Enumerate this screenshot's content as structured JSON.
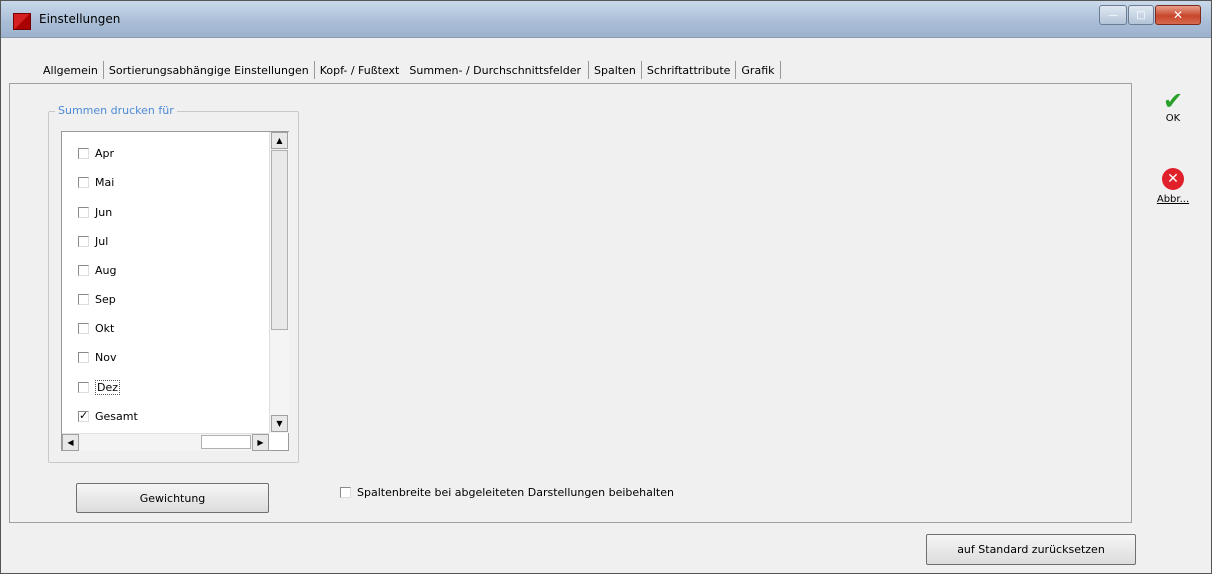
{
  "window": {
    "title": "Einstellungen"
  },
  "tabs": [
    {
      "label": "Allgemein"
    },
    {
      "label": "Sortierungsabhängige Einstellungen"
    },
    {
      "label": "Kopf- / Fußtext"
    },
    {
      "label": "Summen- / Durchschnittsfelder",
      "active": true
    },
    {
      "label": "Spalten"
    },
    {
      "label": "Schriftattribute"
    },
    {
      "label": "Grafik"
    }
  ],
  "group": {
    "title": "Summen drucken für"
  },
  "items": [
    {
      "label": "Apr",
      "checked": false
    },
    {
      "label": "Mai",
      "checked": false
    },
    {
      "label": "Jun",
      "checked": false
    },
    {
      "label": "Jul",
      "checked": false
    },
    {
      "label": "Aug",
      "checked": false
    },
    {
      "label": "Sep",
      "checked": false
    },
    {
      "label": "Okt",
      "checked": false
    },
    {
      "label": "Nov",
      "checked": false
    },
    {
      "label": "Dez",
      "checked": false
    },
    {
      "label": "Gesamt",
      "checked": true
    }
  ],
  "buttons": {
    "weighting": "Gewichtung",
    "reset": "auf Standard zurücksetzen",
    "ok": "OK",
    "cancel": "Abbr..."
  },
  "option": {
    "label": "Spaltenbreite bei abgeleiteten Darstellungen beibehalten",
    "checked": false
  },
  "icons": {
    "ok": "checkmark-icon",
    "cancel": "cancel-x-icon"
  },
  "colors": {
    "group_title": "#4d8bd6",
    "ok": "#2aa02a",
    "cancel": "#e0202b"
  }
}
